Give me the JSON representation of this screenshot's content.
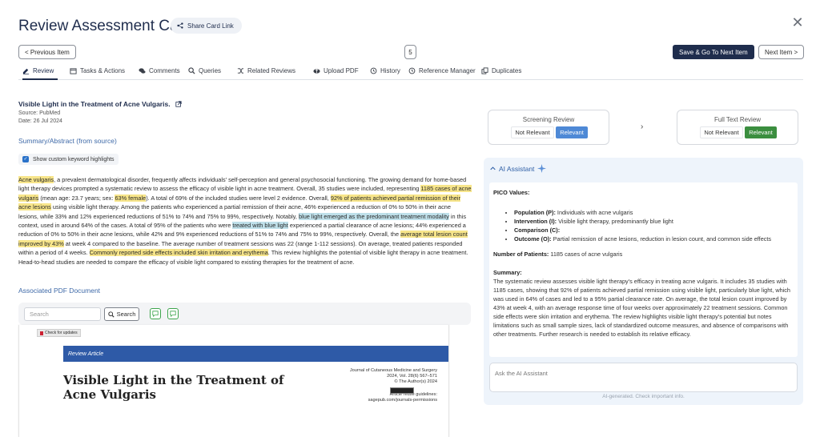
{
  "header": {
    "title": "Review Assessment Card",
    "share_label": "Share Card Link",
    "prev_label": "< Previous Item",
    "counter": "5",
    "save_next_label": "Save & Go To Next Item",
    "next_label": "Next Item >"
  },
  "tabs": [
    {
      "label": "Review",
      "icon": "edit-icon"
    },
    {
      "label": "Tasks & Actions",
      "icon": "calendar-icon"
    },
    {
      "label": "Comments",
      "icon": "comments-icon"
    },
    {
      "label": "Queries",
      "icon": "search-icon"
    },
    {
      "label": "Related Reviews",
      "icon": "shuffle-icon"
    },
    {
      "label": "Upload PDF",
      "icon": "cloud-upload-icon"
    },
    {
      "label": "History",
      "icon": "history-icon"
    },
    {
      "label": "Reference Manager",
      "icon": "history-icon"
    },
    {
      "label": "Duplicates",
      "icon": "copy-icon"
    }
  ],
  "article": {
    "title": "Visible Light in the Treatment of Acne Vulgaris.",
    "source": "Source: PubMed",
    "date": "Date: 26 Jul 2024",
    "summary_title": "Summary/Abstract (from source)",
    "highlight_label": "Show custom keyword highlights",
    "abstract": [
      {
        "t": "Acne vulgaris",
        "h": "y"
      },
      {
        "t": ", a prevalent dermatological disorder, frequently affects individuals' self-perception and general psychosocial functioning. The growing demand for home-based light therapy devices prompted a systematic review to assess the efficacy of visible light in acne treatment. Overall, 35 studies were included, representing ",
        "h": ""
      },
      {
        "t": "1185 cases of acne vulgaris",
        "h": "y"
      },
      {
        "t": " (mean age: 23.7 years; sex: ",
        "h": ""
      },
      {
        "t": "63% female",
        "h": "y"
      },
      {
        "t": "). A total of 69% of the included studies were level 2 evidence. Overall, ",
        "h": ""
      },
      {
        "t": "92% of patients achieved partial remission of their acne lesions",
        "h": "y"
      },
      {
        "t": " using visible light therapy. Among the patients who experienced a partial remission of their acne, 46% experienced a reduction of 0% to 50% in their acne lesions, while 33% and 12% experienced reductions of 51% to 74% and 75% to 99%, respectively. Notably, ",
        "h": ""
      },
      {
        "t": "blue light emerged as the predominant treatment modality",
        "h": "b"
      },
      {
        "t": " in this context, used in around 64% of the cases. A total of 95% of the patients who were ",
        "h": ""
      },
      {
        "t": "treated with blue light",
        "h": "b"
      },
      {
        "t": " experienced a partial clearance of acne lesions; 44% experienced a reduction of 0% to 50% in their acne lesions, while 42% and 9% experienced reductions of 51% to 74% and 75% to 99%, respectively. Overall, the ",
        "h": ""
      },
      {
        "t": "average total lesion count improved by 43%",
        "h": "y"
      },
      {
        "t": " at week 4 compared to the baseline. The average number of treatment sessions was 22 (range 1-112 sessions). On average, treated patients responded within a period of 4 weeks. ",
        "h": ""
      },
      {
        "t": "Commonly reported side effects included skin irritation and erythema",
        "h": "y"
      },
      {
        "t": ". This review highlights the potential of visible light therapy in acne treatment. Head-to-head studies are needed to compare the efficacy of visible light compared to existing therapies for the treatment of acne.",
        "h": ""
      }
    ],
    "pdf_title": "Associated PDF Document"
  },
  "pdf": {
    "search_placeholder": "Search",
    "search_label": "Search",
    "check_updates": "Check for updates",
    "band_label": "Review Article",
    "doc_title": "Visible Light in the Treatment of Acne Vulgaris",
    "journal_lines": [
      "Journal of Cutaneous Medicine and Surgery",
      "2024, Vol. 28(6) 567–571",
      "© The Author(s) 2024"
    ],
    "reuse_lines": [
      "Article reuse guidelines:",
      "sagepub.com/journals-permissions"
    ]
  },
  "screening": {
    "title": "Screening Review",
    "not_relevant": "Not Relevant",
    "relevant": "Relevant"
  },
  "fulltext": {
    "title": "Full Text Review",
    "not_relevant": "Not Relevant",
    "relevant": "Relevant"
  },
  "ai": {
    "title": "AI Assistant",
    "pico_label": "PICO Values:",
    "pico": [
      {
        "k": "Population (P):",
        "v": " Individuals with acne vulgaris"
      },
      {
        "k": "Intervention (I):",
        "v": " Visible light therapy, predominantly blue light"
      },
      {
        "k": "Comparison (C):",
        "v": ""
      },
      {
        "k": "Outcome (O):",
        "v": " Partial remission of acne lesions, reduction in lesion count, and common side effects"
      }
    ],
    "patients_label": "Number of Patients:",
    "patients_value": " 1185 cases of acne vulgaris",
    "summary_label": "Summary:",
    "summary_text": "The systematic review assesses visible light therapy's efficacy in treating acne vulgaris. It includes 35 studies with 1185 cases, showing that 92% of patients achieved partial remission using visible light, particularly blue light, which was used in 64% of cases and led to a 95% partial clearance rate. On average, the total lesion count improved by 43% at week 4, with an average response time of four weeks over approximately 22 treatment sessions. Common side effects were skin irritation and erythema. The review highlights visible light therapy's potential but notes limitations such as small sample sizes, lack of standardized outcome measures, and absence of comparisons with other treatments. Further research is needed to establish its relative efficacy.",
    "input_placeholder": "Ask the AI Assistant",
    "footer": "AI-generated. Check important info."
  },
  "colors": {
    "navy": "#1f2d4d",
    "accent_blue": "#4e89d6",
    "green": "#3b8e3f",
    "highlight_yellow": "#f7e58a",
    "highlight_blue": "#bfe0ea"
  }
}
